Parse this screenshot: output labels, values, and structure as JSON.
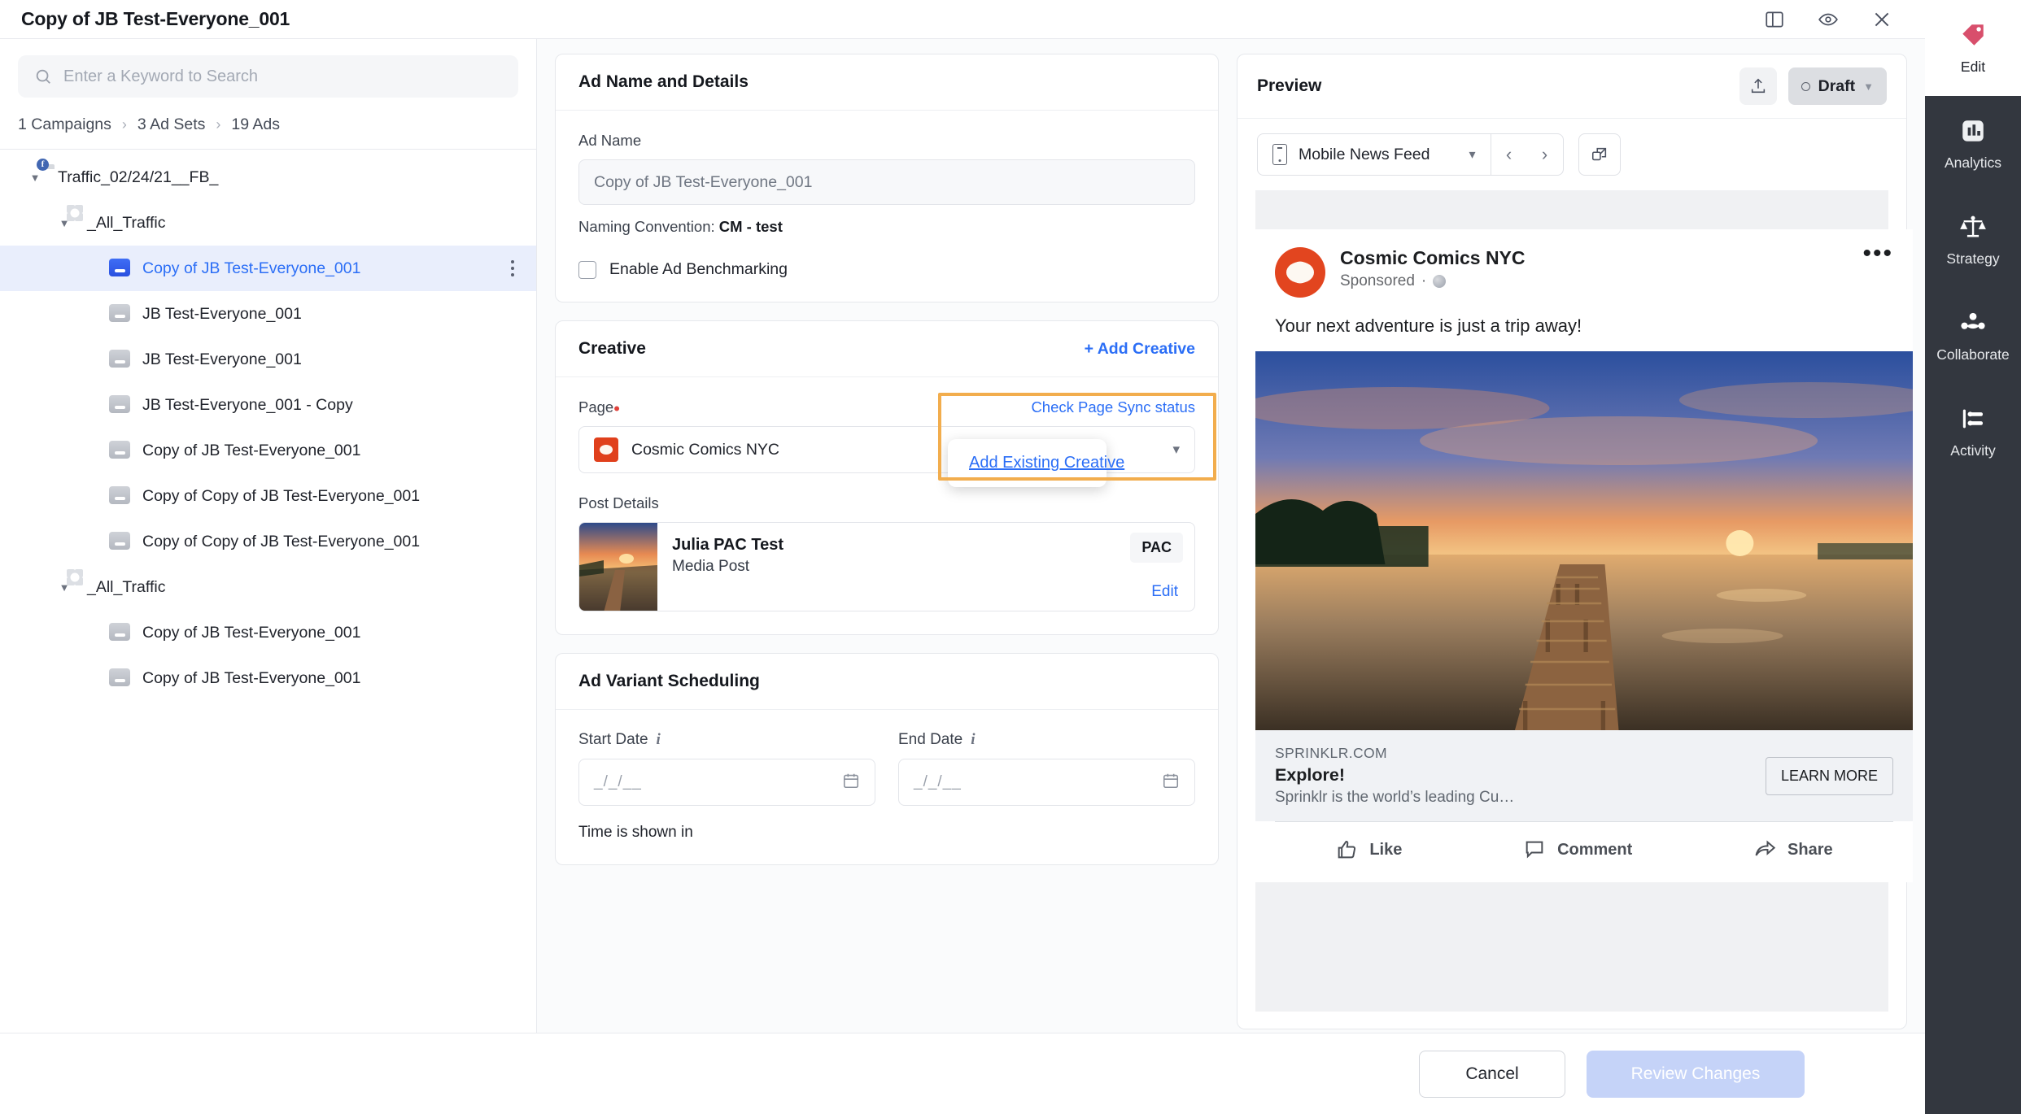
{
  "header": {
    "title": "Copy of JB Test-Everyone_001",
    "icons": [
      {
        "name": "split-panel-icon",
        "glyph": "panel"
      },
      {
        "name": "eye-icon",
        "glyph": "eye"
      },
      {
        "name": "close-icon",
        "glyph": "close"
      }
    ]
  },
  "sidebar": {
    "search_placeholder": "Enter a Keyword to Search",
    "search_value": "",
    "breadcrumb": [
      "1 Campaigns",
      "3 Ad Sets",
      "19 Ads"
    ],
    "tree": [
      {
        "label": "Traffic_02/24/21__FB_",
        "type": "campaign",
        "depth": 0,
        "caret": "down",
        "selected": false
      },
      {
        "label": "_All_Traffic",
        "type": "adset",
        "depth": 1,
        "caret": "down",
        "selected": false
      },
      {
        "label": "Copy of JB Test-Everyone_001",
        "type": "ad",
        "depth": 2,
        "caret": "none",
        "selected": true
      },
      {
        "label": "JB Test-Everyone_001",
        "type": "ad",
        "depth": 2,
        "caret": "none",
        "selected": false
      },
      {
        "label": "JB Test-Everyone_001",
        "type": "ad",
        "depth": 2,
        "caret": "none",
        "selected": false
      },
      {
        "label": "JB Test-Everyone_001 - Copy",
        "type": "ad",
        "depth": 2,
        "caret": "none",
        "selected": false
      },
      {
        "label": "Copy of JB Test-Everyone_001",
        "type": "ad",
        "depth": 2,
        "caret": "none",
        "selected": false
      },
      {
        "label": "Copy of Copy of JB Test-Everyone_001",
        "type": "ad",
        "depth": 2,
        "caret": "none",
        "selected": false
      },
      {
        "label": "Copy of Copy of JB Test-Everyone_001",
        "type": "ad",
        "depth": 2,
        "caret": "none",
        "selected": false
      },
      {
        "label": "_All_Traffic",
        "type": "adset",
        "depth": 1,
        "caret": "down",
        "selected": false
      },
      {
        "label": "Copy of JB Test-Everyone_001",
        "type": "ad",
        "depth": 2,
        "caret": "none",
        "selected": false
      },
      {
        "label": "Copy of JB Test-Everyone_001",
        "type": "ad",
        "depth": 2,
        "caret": "none",
        "selected": false
      }
    ]
  },
  "ad_details": {
    "card_title": "Ad Name and Details",
    "ad_name_label": "Ad Name",
    "ad_name_value": "Copy of JB Test-Everyone_001",
    "naming_prefix": "Naming Convention:",
    "naming_value": "CM - test",
    "benchmark_label": "Enable Ad Benchmarking",
    "benchmark_checked": false
  },
  "creative": {
    "card_title": "Creative",
    "add_creative_label": "+ Add Creative",
    "menu_item_label": "Add Existing Creative",
    "page_label": "Page",
    "page_required": true,
    "sync_link_label": "Check Page Sync status",
    "page_value": "Cosmic Comics NYC",
    "post_details_label": "Post Details",
    "post_title": "Julia PAC Test",
    "post_subtitle": "Media Post",
    "post_badge": "PAC",
    "post_edit_label": "Edit"
  },
  "scheduling": {
    "card_title": "Ad Variant Scheduling",
    "start_label": "Start Date",
    "start_placeholder": "_/_/__",
    "start_value": "",
    "end_label": "End Date",
    "end_placeholder": "_/_/__",
    "end_value": "",
    "time_note": "Time is shown in"
  },
  "preview": {
    "title": "Preview",
    "status_label": "Draft",
    "platform_label": "Mobile News Feed",
    "ad": {
      "page_name": "Cosmic Comics NYC",
      "sponsored_label": "Sponsored",
      "primary_text": "Your next adventure is just a trip away!",
      "link_domain": "SPRINKLR.COM",
      "headline": "Explore!",
      "description": "Sprinklr is the world’s leading Cu…",
      "cta_label": "LEARN MORE",
      "actions": [
        "Like",
        "Comment",
        "Share"
      ]
    }
  },
  "footer": {
    "cancel_label": "Cancel",
    "review_label": "Review Changes"
  },
  "rail": {
    "items": [
      {
        "label": "Edit",
        "icon": "tag-icon",
        "active": true
      },
      {
        "label": "Analytics",
        "icon": "bar-chart-icon",
        "active": false
      },
      {
        "label": "Strategy",
        "icon": "scales-icon",
        "active": false
      },
      {
        "label": "Collaborate",
        "icon": "people-icon",
        "active": false
      },
      {
        "label": "Activity",
        "icon": "activity-icon",
        "active": false
      }
    ]
  },
  "colors": {
    "accent_blue": "#2b6ef6",
    "highlight_orange": "#f2ad4d",
    "rail_dark": "#33373f",
    "edit_tag_pink": "#d84f6c",
    "selected_row": "#e9eefc"
  }
}
